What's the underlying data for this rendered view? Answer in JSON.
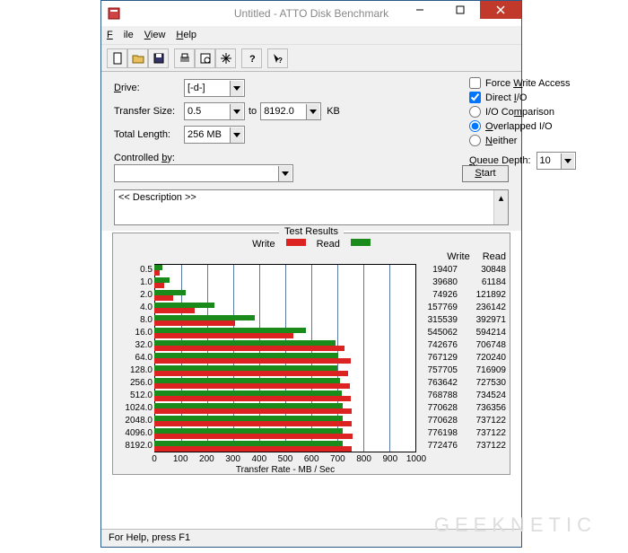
{
  "window": {
    "title": "Untitled - ATTO Disk Benchmark"
  },
  "menu": {
    "file": "File",
    "view": "View",
    "help": "Help"
  },
  "form": {
    "drive_label": "Drive:",
    "drive_value": "[-d-]",
    "transfer_label": "Transfer Size:",
    "transfer_from": "0.5",
    "to_label": "to",
    "transfer_to": "8192.0",
    "kb": "KB",
    "length_label": "Total Length:",
    "length_value": "256 MB",
    "force_write": "Force Write Access",
    "direct_io": "Direct I/O",
    "io_comparison": "I/O Comparison",
    "overlapped": "Overlapped I/O",
    "neither": "Neither",
    "queue_label": "Queue Depth:",
    "queue_value": "10",
    "controlled_label": "Controlled by:",
    "start": "Start",
    "description": "<< Description >>"
  },
  "results": {
    "title": "Test Results",
    "write_label": "Write",
    "read_label": "Read",
    "xtitle": "Transfer Rate - MB / Sec",
    "value_head_write": "Write",
    "value_head_read": "Read"
  },
  "chart_data": {
    "type": "bar",
    "orientation": "horizontal",
    "categories": [
      "0.5",
      "1.0",
      "2.0",
      "4.0",
      "8.0",
      "16.0",
      "32.0",
      "64.0",
      "128.0",
      "256.0",
      "512.0",
      "1024.0",
      "2048.0",
      "4096.0",
      "8192.0"
    ],
    "series": [
      {
        "name": "Write",
        "color": "#d22",
        "values_kb": [
          19407,
          39680,
          74926,
          157769,
          315539,
          545062,
          742676,
          767129,
          757705,
          763642,
          768788,
          770628,
          770628,
          776198,
          772476
        ]
      },
      {
        "name": "Read",
        "color": "#1a8a1a",
        "values_kb": [
          30848,
          61184,
          121892,
          236142,
          392971,
          594214,
          706748,
          720240,
          716909,
          727530,
          734524,
          736356,
          737122,
          737122,
          737122
        ]
      }
    ],
    "xlabel": "Transfer Rate - MB / Sec",
    "xticks": [
      0,
      100,
      200,
      300,
      400,
      500,
      600,
      700,
      800,
      900,
      1000
    ],
    "xlim": [
      0,
      1000
    ]
  },
  "status": {
    "text": "For Help, press F1"
  },
  "watermark": "GEEKNETIC"
}
